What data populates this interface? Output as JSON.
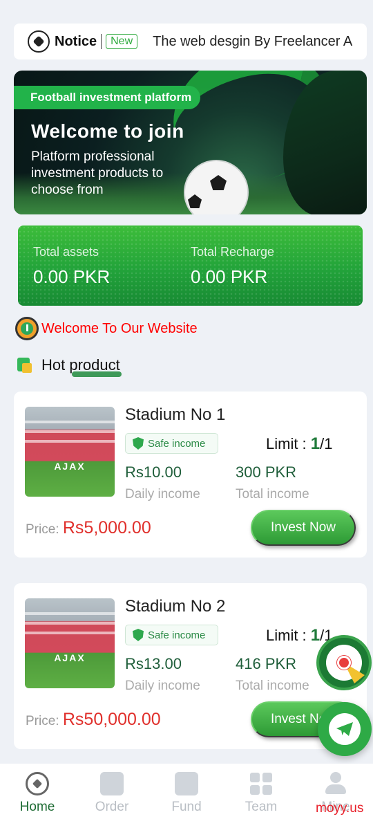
{
  "notice": {
    "title": "Notice",
    "badge": "New",
    "text": "The web desgin By Freelancer A"
  },
  "banner": {
    "tag": "Football investment platform",
    "headline": "Welcome to join",
    "subtitle": "Platform professional investment products to choose from"
  },
  "assets": {
    "total_assets_label": "Total assets",
    "total_assets_value": "0.00 PKR",
    "total_recharge_label": "Total Recharge",
    "total_recharge_value": "0.00 PKR"
  },
  "welcome_text": "Welcome To Our Website",
  "hot_product_title": "Hot product",
  "products": [
    {
      "name": "Stadium No 1",
      "safe_label": "Safe income",
      "limit_label": "Limit : ",
      "limit_used": "1",
      "limit_total": "/1",
      "daily_value": "Rs10.00",
      "daily_label": "Daily income",
      "total_value": "300 PKR",
      "total_label": "Total income",
      "price_label": "Price: ",
      "price_value": "Rs5,000.00",
      "button": "Invest Now",
      "image_text": "AJAX"
    },
    {
      "name": "Stadium No 2",
      "safe_label": "Safe income",
      "limit_label": "Limit : ",
      "limit_used": "1",
      "limit_total": "/1",
      "daily_value": "Rs13.00",
      "daily_label": "Daily income",
      "total_value": "416 PKR",
      "total_label": "Total income",
      "price_label": "Price: ",
      "price_value": "Rs50,000.00",
      "button": "Invest Now",
      "image_text": "AJAX"
    }
  ],
  "tabbar": [
    {
      "label": "Home",
      "icon": "football-icon",
      "active": true
    },
    {
      "label": "Order",
      "icon": "list-icon",
      "active": false
    },
    {
      "label": "Fund",
      "icon": "chart-icon",
      "active": false
    },
    {
      "label": "Team",
      "icon": "grid-icon",
      "active": false
    },
    {
      "label": "Mine",
      "icon": "user-icon",
      "active": false
    }
  ],
  "watermark": "moyy.us",
  "colors": {
    "primary_green": "#22a33a",
    "price_red": "#e0302c",
    "welcome_red": "#ff0000"
  }
}
